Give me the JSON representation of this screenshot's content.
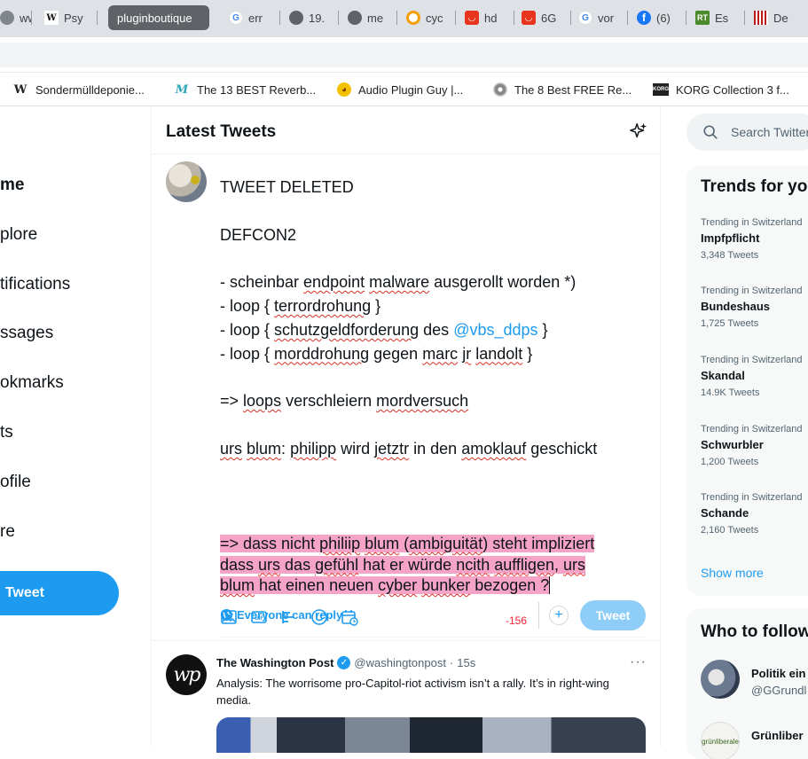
{
  "browser": {
    "tabs": [
      {
        "label": "ww",
        "icon": "globe-icon"
      },
      {
        "label": "Psy",
        "icon": "wikipedia-icon"
      },
      {
        "label": "pluginboutique",
        "icon": "",
        "active": true
      },
      {
        "label": "err",
        "icon": "google-icon"
      },
      {
        "label": "19.",
        "icon": "globe-icon"
      },
      {
        "label": "me",
        "icon": "globe-icon"
      },
      {
        "label": "cyc",
        "icon": "orange-ring-icon"
      },
      {
        "label": "hd",
        "icon": "red-bag-icon"
      },
      {
        "label": "6G",
        "icon": "red-bag-icon"
      },
      {
        "label": "vor",
        "icon": "google-icon"
      },
      {
        "label": "(6)",
        "icon": "facebook-icon"
      },
      {
        "label": "Es",
        "icon": "rt-icon"
      },
      {
        "label": "De",
        "icon": "red-bars-icon"
      }
    ],
    "bookmarks": [
      {
        "label": "Sondermülldeponie...",
        "icon": "wikipedia-icon"
      },
      {
        "label": "The 13 BEST Reverb...",
        "icon": "m-script-icon"
      },
      {
        "label": "Audio Plugin Guy |...",
        "icon": "emoji-face-icon"
      },
      {
        "label": "The 8 Best FREE Re...",
        "icon": "disc-icon"
      },
      {
        "label": "KORG Collection 3 f...",
        "icon": "korg-icon"
      }
    ]
  },
  "nav": {
    "items": [
      "me",
      "plore",
      "tifications",
      "ssages",
      "okmarks",
      "ts",
      "ofile",
      "re"
    ],
    "tweet_button": "Tweet"
  },
  "main": {
    "title": "Latest Tweets",
    "compose": {
      "reply_setting": "Everyone can reply",
      "counter": "-156",
      "tweet_button": "Tweet",
      "plus": "+"
    },
    "feed": {
      "name": "The Washington Post",
      "handle": "@washingtonpost",
      "dot": "·",
      "time": "15s",
      "text": "Analysis: The worrisome pro-Capitol-riot activism isn’t a rally. It’s in right-wing media.",
      "more": "···",
      "avatar_text": "wp"
    }
  },
  "draft": {
    "l1": "TWEET DELETED",
    "l3": "DEFCON2",
    "l5a": "- scheinbar ",
    "l5b": "endpoint",
    "l5c": " ",
    "l5d": "malware",
    "l5e": " ausgerollt worden *)",
    "l6a": "- loop { ",
    "l6b": "terrordrohung",
    "l6c": " }",
    "l7a": "- loop { ",
    "l7b": "schutzgeldforderung",
    "l7c": " des ",
    "l7d": "@vbs_ddps",
    "l7e": " }",
    "l8a": "- loop { ",
    "l8b": "morddrohung",
    "l8c": " gegen ",
    "l8d": "marc",
    "l8e": " ",
    "l8f": "jr",
    "l8g": " ",
    "l8h": "landolt",
    "l8i": " }",
    "l10a": "=> ",
    "l10b": "loops",
    "l10c": " verschleiern ",
    "l10d": "mordversuch",
    "l12a": "urs",
    "l12b": " ",
    "l12c": "blum",
    "l12d": ": ",
    "l12e": "philipp",
    "l12f": " wird ",
    "l12g": "jetztr",
    "l12h": " in den ",
    "l12i": "amoklauf",
    "l12j": " geschickt",
    "h1a": "=> dass nicht ",
    "h1b": "philiip",
    "h1c": " ",
    "h1d": "blum",
    "h1e": " (",
    "h1f": "ambiguität",
    "h1g": ") steht impliziert",
    "h2a": "dass ",
    "h2b": "urs",
    "h2c": " das ",
    "h2d": "gefühl",
    "h2e": " hat er würde ",
    "h2f": "ncith",
    "h2g": " ",
    "h2h": "auffligen",
    "h2i": ", ",
    "h2j": "urs",
    "h3a": "blum",
    "h3b": " hat einen neuen ",
    "h3c": "cyber",
    "h3d": " ",
    "h3e": "bunker",
    "h3f": " bezogen ?"
  },
  "right": {
    "search_placeholder": "Search Twitter",
    "trends_title": "Trends for you",
    "trends": [
      {
        "context": "Trending in Switzerland",
        "name": "Impfpflicht",
        "count": "3,348 Tweets"
      },
      {
        "context": "Trending in Switzerland",
        "name": "Bundeshaus",
        "count": "1,725 Tweets"
      },
      {
        "context": "Trending in Switzerland",
        "name": "Skandal",
        "count": "14.9K Tweets"
      },
      {
        "context": "Trending in Switzerland",
        "name": "Schwurbler",
        "count": "1,200 Tweets"
      },
      {
        "context": "Trending in Switzerland",
        "name": "Schande",
        "count": "2,160 Tweets"
      }
    ],
    "show_more": "Show more",
    "follow_title": "Who to follow",
    "follow": [
      {
        "name": "Politik ein",
        "handle": "@GGrundl"
      },
      {
        "name": "Grünliber",
        "handle": "",
        "avatar_text": "grünliberale"
      }
    ]
  },
  "colors": {
    "accent": "#1d9bf0",
    "highlight": "#f5a3c7",
    "counter": "#f4212e"
  }
}
